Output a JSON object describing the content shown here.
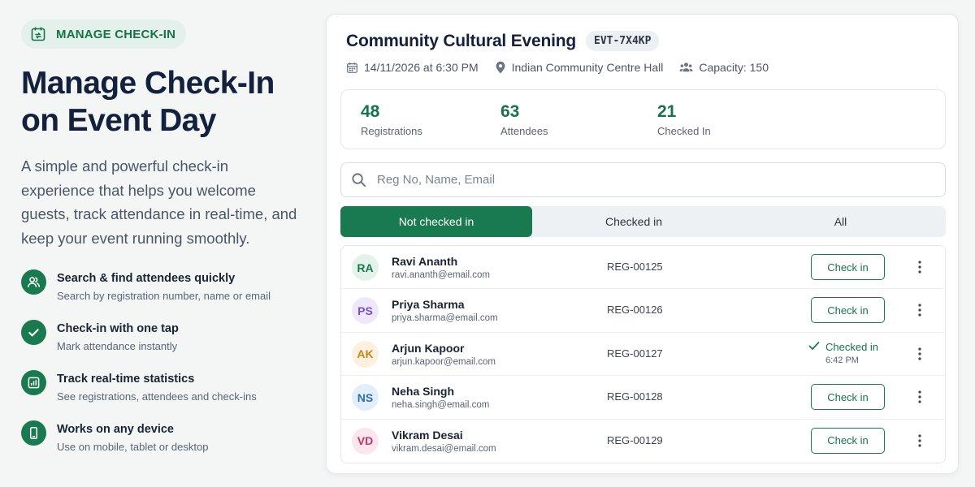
{
  "badge": {
    "label": "MANAGE CHECK-IN",
    "icon": "calendar-refresh-icon"
  },
  "hero": {
    "title_line1": "Manage Check-In",
    "title_line2": "on Event Day",
    "description": "A simple and powerful check-in experience that helps you welcome guests, track attendance in real-time, and keep your event running smoothly."
  },
  "features": [
    {
      "icon": "people-icon",
      "title": "Search & find attendees quickly",
      "subtitle": "Search by registration number, name or email"
    },
    {
      "icon": "check-icon",
      "title": "Check-in with one tap",
      "subtitle": "Mark attendance instantly"
    },
    {
      "icon": "bar-chart-icon",
      "title": "Track real-time statistics",
      "subtitle": "See registrations, attendees and check-ins"
    },
    {
      "icon": "mobile-device-icon",
      "title": "Works on any device",
      "subtitle": "Use on mobile, tablet or desktop"
    }
  ],
  "event": {
    "title": "Community Cultural Evening",
    "code": "EVT-7X4KP",
    "datetime": "14/11/2026 at 6:30 PM",
    "venue": "Indian Community Centre Hall",
    "capacity": "Capacity: 150"
  },
  "stats": [
    {
      "value": "48",
      "label": "Registrations"
    },
    {
      "value": "63",
      "label": "Attendees"
    },
    {
      "value": "21",
      "label": "Checked In"
    }
  ],
  "search": {
    "placeholder": "Reg No, Name, Email",
    "value": ""
  },
  "tabs": [
    {
      "label": "Not checked in",
      "active": true
    },
    {
      "label": "Checked in",
      "active": false
    },
    {
      "label": "All",
      "active": false
    }
  ],
  "attendees": [
    {
      "initials": "RA",
      "name": "Ravi Ananth",
      "email": "ravi.ananth@email.com",
      "reg": "REG-00125",
      "checked_in": false,
      "action_label": "Check in",
      "avatar_bg": "#e3f3ea",
      "avatar_fg": "#1a7a4f"
    },
    {
      "initials": "PS",
      "name": "Priya Sharma",
      "email": "priya.sharma@email.com",
      "reg": "REG-00126",
      "checked_in": false,
      "action_label": "Check in",
      "avatar_bg": "#efe8fb",
      "avatar_fg": "#7a4fc4"
    },
    {
      "initials": "AK",
      "name": "Arjun Kapoor",
      "email": "arjun.kapoor@email.com",
      "reg": "REG-00127",
      "checked_in": true,
      "status_label": "Checked in",
      "checkin_time": "6:42 PM",
      "avatar_bg": "#fcf1df",
      "avatar_fg": "#c2871d"
    },
    {
      "initials": "NS",
      "name": "Neha Singh",
      "email": "neha.singh@email.com",
      "reg": "REG-00128",
      "checked_in": false,
      "action_label": "Check in",
      "avatar_bg": "#e3eefb",
      "avatar_fg": "#2d6bb8"
    },
    {
      "initials": "VD",
      "name": "Vikram Desai",
      "email": "vikram.desai@email.com",
      "reg": "REG-00129",
      "checked_in": false,
      "action_label": "Check in",
      "avatar_bg": "#fbe6ee",
      "avatar_fg": "#c2356a"
    }
  ],
  "colors": {
    "accent": "#1a7a4f",
    "accent_light": "#e3f1ea",
    "text_dark": "#14213d"
  }
}
